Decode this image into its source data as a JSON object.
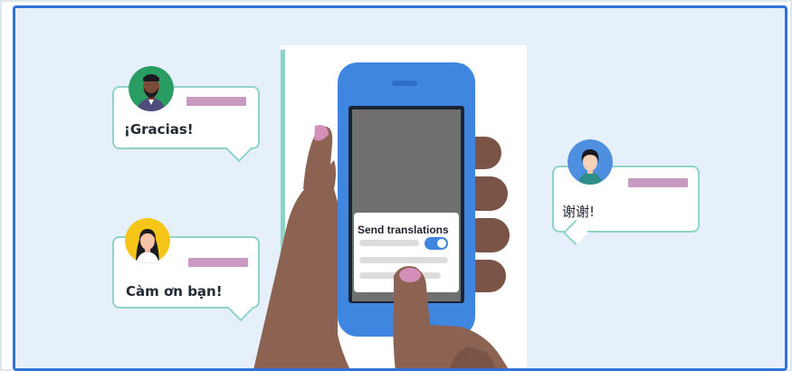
{
  "bubbles": {
    "spanish": {
      "text": "¡Gracias!"
    },
    "vietnamese": {
      "text": "Càm ơn bạn!"
    },
    "chinese": {
      "text": "谢谢!"
    }
  },
  "phone": {
    "popup_title": "Send translations",
    "toggle_on": true
  },
  "colors": {
    "frame_border": "#2f73d9",
    "background": "#e6f0fa",
    "bubble_border": "#8fd3c5",
    "name_bar": "#c99ac1",
    "phone_body": "#3f86e0",
    "skin": "#8c6253"
  },
  "icons": {
    "avatar_man": "avatar-icon",
    "avatar_woman": "avatar-icon",
    "toggle": "toggle-switch-icon"
  }
}
